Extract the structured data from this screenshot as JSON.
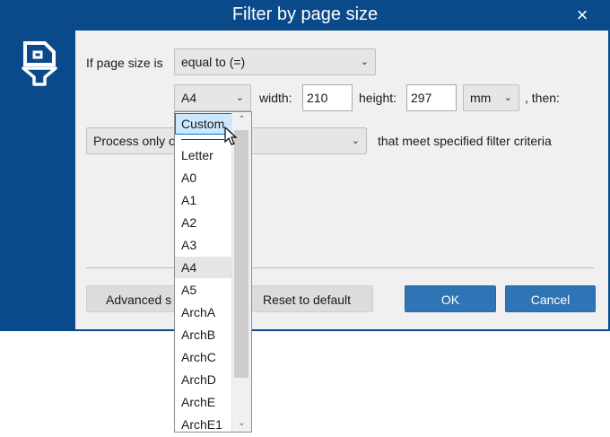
{
  "dialog": {
    "title": "Filter by page size",
    "close_icon": "×"
  },
  "criteria": {
    "if_label": "If page size is",
    "comparison": "equal to (=)",
    "size_selected": "A4",
    "width_label": "width:",
    "width_value": "210",
    "height_label": "height:",
    "height_value": "297",
    "unit": "mm",
    "then_label": ", then:"
  },
  "action": {
    "selected": "Process only o",
    "suffix": "that meet specified filter criteria"
  },
  "buttons": {
    "advanced": "Advanced s",
    "reset": "Reset to default",
    "ok": "OK",
    "cancel": "Cancel"
  },
  "dropdown": {
    "items": [
      "Custom",
      "Letter",
      "A0",
      "A1",
      "A2",
      "A3",
      "A4",
      "A5",
      "ArchA",
      "ArchB",
      "ArchC",
      "ArchD",
      "ArchE",
      "ArchE1"
    ],
    "highlighted": "Custom",
    "current": "A4"
  },
  "icons": {
    "dialog_icon": "filter-page-icon",
    "chevron": "chevron-down-icon",
    "cursor": "mouse-pointer-icon"
  },
  "colors": {
    "titlebar": "#0b4a8a",
    "primary_button": "#2f74b5",
    "highlight": "#cce8ff"
  }
}
